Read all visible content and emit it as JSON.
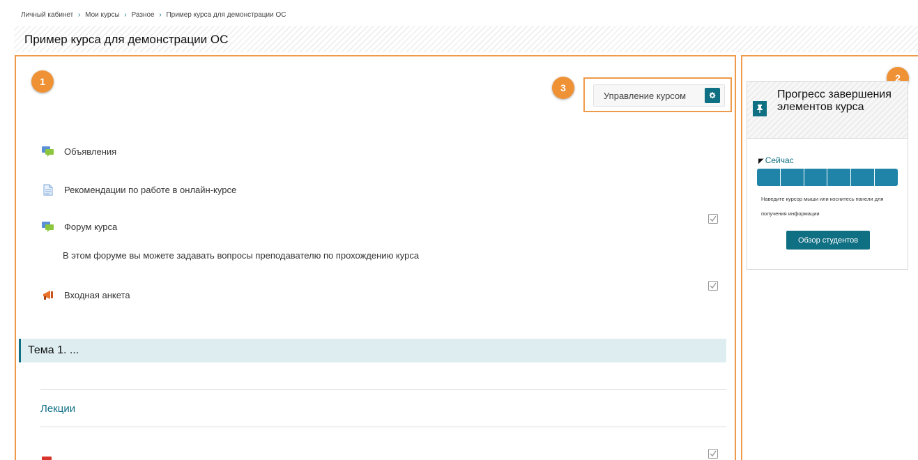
{
  "breadcrumb": {
    "items": [
      "Личный кабинет",
      "Мои курсы",
      "Разное",
      "Пример курса для демонстрации ОС"
    ],
    "separator": "›"
  },
  "page_title": "Пример курса для демонстрации ОС",
  "badges": [
    "1",
    "2",
    "3"
  ],
  "course_admin": {
    "label": "Управление курсом",
    "icon": "gear-icon"
  },
  "activities": [
    {
      "label": "Объявления",
      "icon": "forum-icon"
    },
    {
      "label": "Рекомендации по работе в онлайн-курсе",
      "icon": "page-icon"
    },
    {
      "label": "Форум курса",
      "icon": "forum-icon",
      "description": "В этом форуме вы можете задавать вопросы преподавателю по прохождению курса"
    },
    {
      "label": "Входная анкета",
      "icon": "feedback-icon"
    }
  ],
  "section": {
    "title": "Тема 1. ..."
  },
  "subsection": {
    "title": "Лекции"
  },
  "progress_block": {
    "title": "Прогресс завершения элементов курса",
    "now_label": "Сейчас",
    "segments": 6,
    "hint": "Наведите курсор мыши или коснитесь панели для получения информации",
    "button": "Обзор студентов"
  },
  "colors": {
    "accent": "#0f6f83",
    "highlight_border": "#ef9a4a",
    "badge": "#ef9235",
    "progress": "#2083a8",
    "section_bg": "#ddedf0"
  }
}
